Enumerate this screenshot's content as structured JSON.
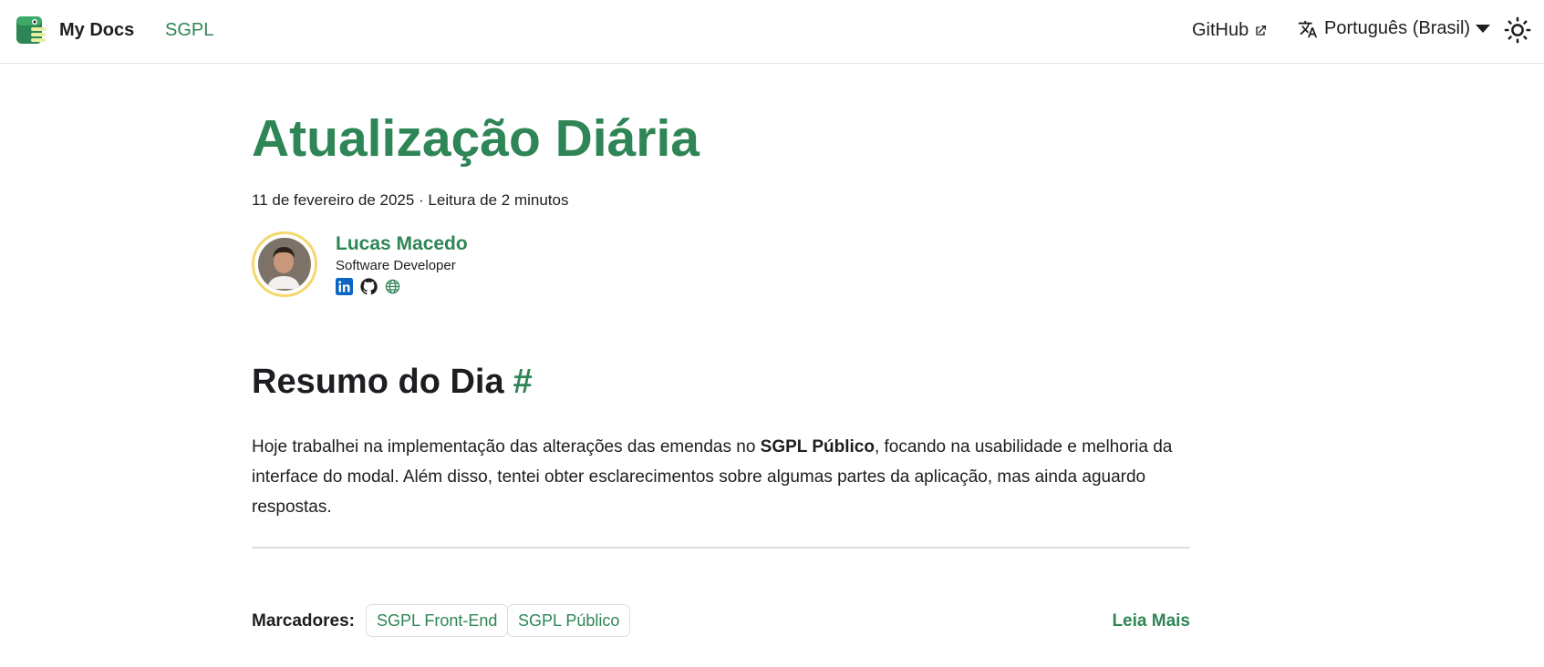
{
  "navbar": {
    "brand_title": "My Docs",
    "links": {
      "sgpl": "SGPL",
      "github": "GitHub"
    },
    "language": "Português (Brasil)"
  },
  "post": {
    "title": "Atualização Diária",
    "meta": "11 de fevereiro de 2025 · Leitura de 2 minutos",
    "author": {
      "name": "Lucas Macedo",
      "role": "Software Developer",
      "socials": [
        "linkedin-icon",
        "github-icon",
        "globe-icon"
      ]
    },
    "section_heading": "Resumo do Dia",
    "hash": "#",
    "paragraph": {
      "before": "Hoje trabalhei na implementação das alterações das emendas no ",
      "bold": "SGPL Público",
      "after": ", focando na usabilidade e melhoria da interface do modal. Além disso, tentei obter esclarecimentos sobre algumas partes da aplicação, mas ainda aguardo respostas."
    },
    "tags_label": "Marcadores:",
    "tags": [
      "SGPL Front-End",
      "SGPL Público"
    ],
    "read_more": "Leia Mais"
  },
  "colors": {
    "accent": "#2e8555",
    "text": "#1c1e21",
    "avatar_ring": "#f5d76e",
    "linkedin": "#0a66c2"
  }
}
